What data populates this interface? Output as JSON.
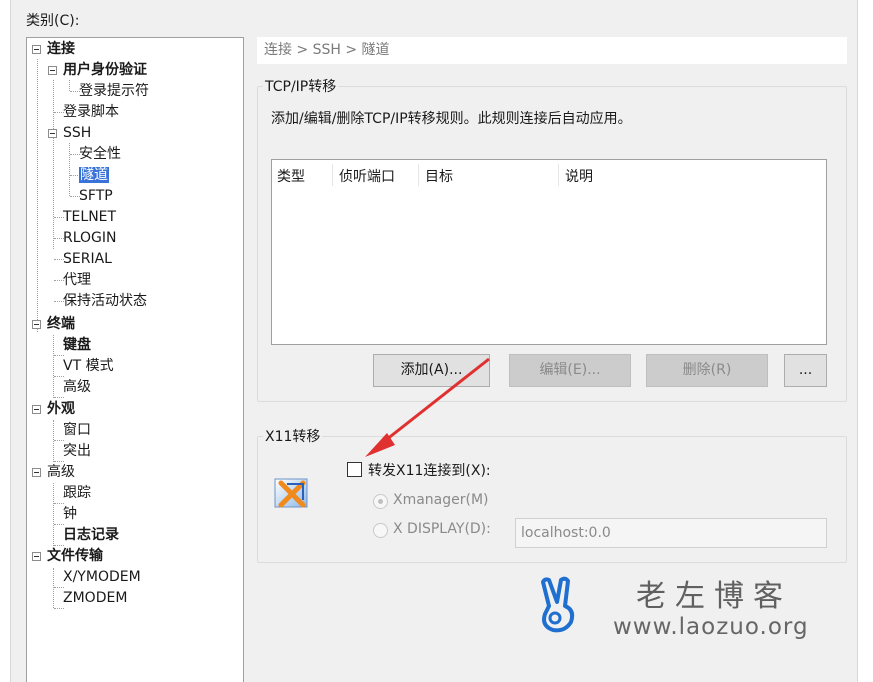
{
  "category_label": "类别(C):",
  "tree": [
    {
      "label": "连接",
      "bold": true
    },
    {
      "label": "用户身份验证",
      "bold": true
    },
    {
      "label": "登录提示符",
      "bold": false
    },
    {
      "label": "登录脚本",
      "bold": false
    },
    {
      "label": "SSH",
      "bold": false
    },
    {
      "label": "安全性",
      "bold": false
    },
    {
      "label": "隧道",
      "bold": false,
      "selected": true
    },
    {
      "label": "SFTP",
      "bold": false
    },
    {
      "label": "TELNET",
      "bold": false
    },
    {
      "label": "RLOGIN",
      "bold": false
    },
    {
      "label": "SERIAL",
      "bold": false
    },
    {
      "label": "代理",
      "bold": false
    },
    {
      "label": "保持活动状态",
      "bold": false
    },
    {
      "label": "终端",
      "bold": true
    },
    {
      "label": "键盘",
      "bold": true
    },
    {
      "label": "VT 模式",
      "bold": false
    },
    {
      "label": "高级",
      "bold": false
    },
    {
      "label": "外观",
      "bold": true
    },
    {
      "label": "窗口",
      "bold": false
    },
    {
      "label": "突出",
      "bold": false
    },
    {
      "label": "高级",
      "bold": false
    },
    {
      "label": "跟踪",
      "bold": false
    },
    {
      "label": "钟",
      "bold": false
    },
    {
      "label": "日志记录",
      "bold": true
    },
    {
      "label": "文件传输",
      "bold": true
    },
    {
      "label": "X/YMODEM",
      "bold": false
    },
    {
      "label": "ZMODEM",
      "bold": false
    }
  ],
  "breadcrumb": "连接 > SSH > 隧道",
  "tcp": {
    "group_title": "TCP/IP转移",
    "description": "添加/编辑/删除TCP/IP转移规则。此规则连接后自动应用。",
    "columns": [
      "类型",
      "侦听端口",
      "目标",
      "说明"
    ],
    "buttons": {
      "add": "添加(A)...",
      "edit": "编辑(E)...",
      "delete": "删除(R)",
      "more": "..."
    }
  },
  "x11": {
    "group_title": "X11转移",
    "forward_label": "转发X11连接到(X):",
    "forward_checked": false,
    "xmanager_label": "Xmanager(M)",
    "xdisplay_label": "X DISPLAY(D):",
    "xdisplay_value": "localhost:0.0"
  },
  "watermark": {
    "text": "老左博客",
    "url": "www.laozuo.org"
  },
  "colors": {
    "selection": "#3a73d8",
    "arrow": "#e03030",
    "logo": "#1e6fd0"
  }
}
